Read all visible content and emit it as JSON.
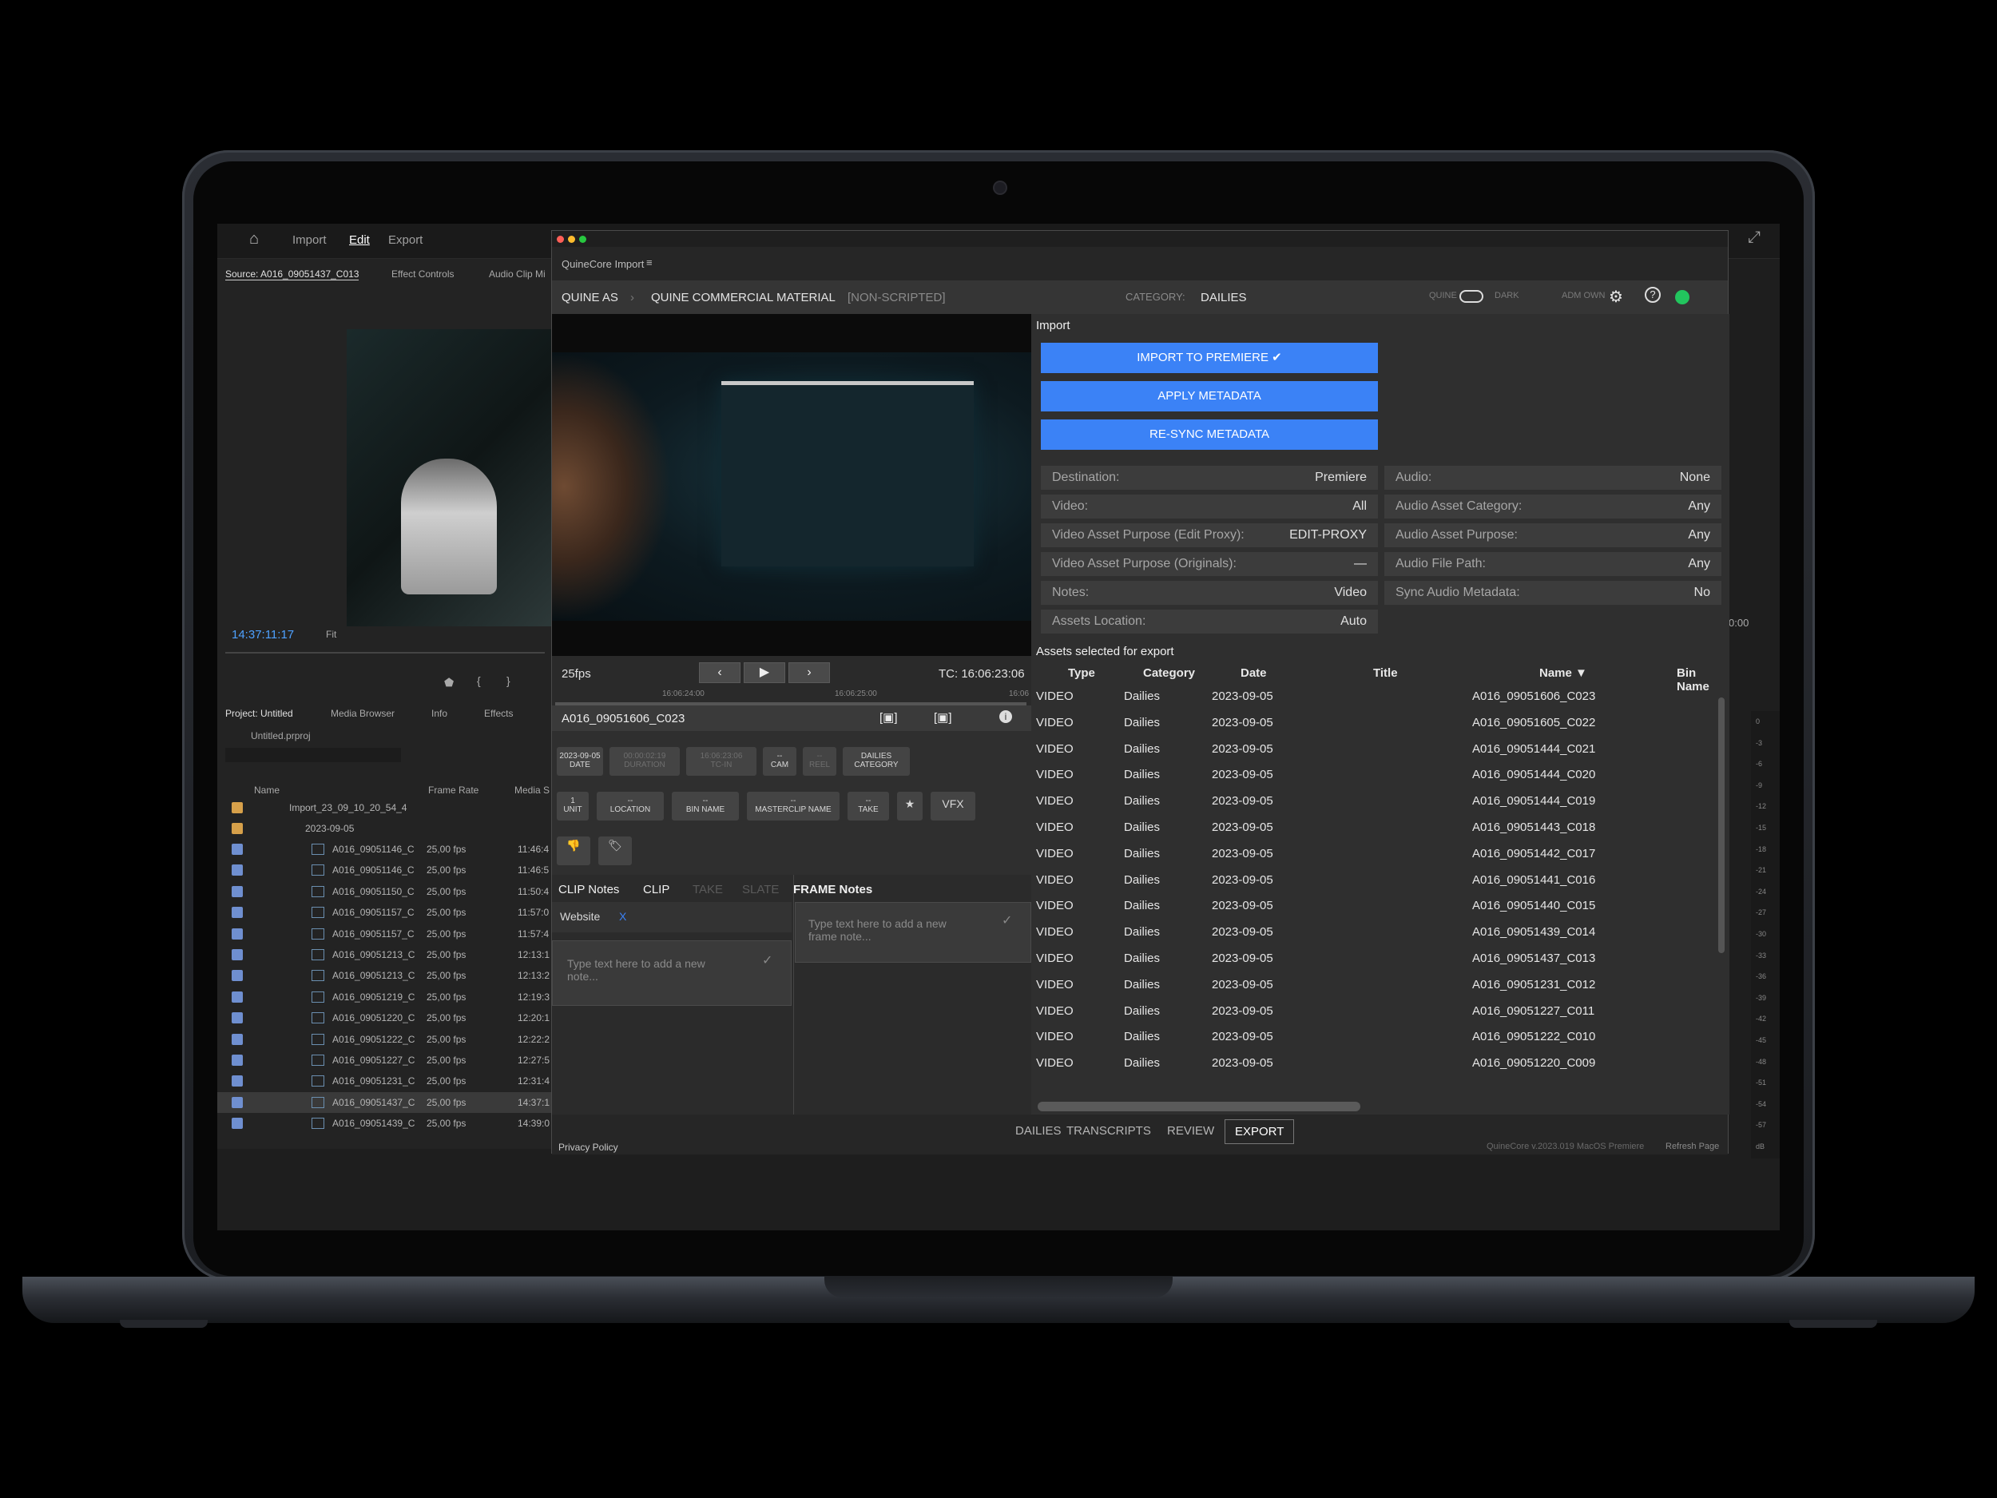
{
  "premiere": {
    "nav": [
      "Import",
      "Edit",
      "Export"
    ],
    "source_tab": "Source: A016_09051437_C013",
    "effect_controls": "Effect Controls",
    "audio_clip_mixer": "Audio Clip Mi",
    "timecode": "14:37:11:17",
    "fit": "Fit",
    "project_tabs": [
      "Project: Untitled",
      "Media Browser",
      "Info",
      "Effects"
    ],
    "project_file": "Untitled.prproj",
    "col_name": "Name",
    "col_frame_rate": "Frame Rate",
    "col_media": "Media S",
    "folder": "Import_23_09_10_20_54_4",
    "subfolder": "2023-09-05",
    "clips": [
      {
        "name": "A016_09051146_C",
        "fps": "25,00 fps",
        "tc": "11:46:4"
      },
      {
        "name": "A016_09051146_C",
        "fps": "25,00 fps",
        "tc": "11:46:5"
      },
      {
        "name": "A016_09051150_C",
        "fps": "25,00 fps",
        "tc": "11:50:4"
      },
      {
        "name": "A016_09051157_C",
        "fps": "25,00 fps",
        "tc": "11:57:0"
      },
      {
        "name": "A016_09051157_C",
        "fps": "25,00 fps",
        "tc": "11:57:4"
      },
      {
        "name": "A016_09051213_C",
        "fps": "25,00 fps",
        "tc": "12:13:1"
      },
      {
        "name": "A016_09051213_C",
        "fps": "25,00 fps",
        "tc": "12:13:2"
      },
      {
        "name": "A016_09051219_C",
        "fps": "25,00 fps",
        "tc": "12:19:3"
      },
      {
        "name": "A016_09051220_C",
        "fps": "25,00 fps",
        "tc": "12:20:1"
      },
      {
        "name": "A016_09051222_C",
        "fps": "25,00 fps",
        "tc": "12:22:2"
      },
      {
        "name": "A016_09051227_C",
        "fps": "25,00 fps",
        "tc": "12:27:5"
      },
      {
        "name": "A016_09051231_C",
        "fps": "25,00 fps",
        "tc": "12:31:4"
      },
      {
        "name": "A016_09051437_C",
        "fps": "25,00 fps",
        "tc": "14:37:1"
      },
      {
        "name": "A016_09051439_C",
        "fps": "25,00 fps",
        "tc": "14:39:0"
      }
    ],
    "right_tc": "0:00"
  },
  "plugin": {
    "window_title": "QuineCore Import",
    "breadcrumb": [
      "QUINE AS",
      "QUINE COMMERCIAL MATERIAL",
      "[NON-SCRIPTED]"
    ],
    "category_label": "CATEGORY:",
    "category_value": "DAILIES",
    "toggle_left": "QUINE",
    "toggle_right": "DARK",
    "user": "ADM  OWN",
    "fps": "25fps",
    "tc": "TC: 16:06:23:06",
    "tick1": "16:06:24:00",
    "tick2": "16:06:25:00",
    "tick3": "16:06",
    "clip_name": "A016_09051606_C023",
    "chips_row1": [
      {
        "top": "2023-09-05",
        "bottom": "DATE",
        "dim": false
      },
      {
        "top": "00:00:02:19",
        "bottom": "DURATION",
        "dim": true
      },
      {
        "top": "16:06:23:06",
        "bottom": "TC-IN",
        "dim": true
      },
      {
        "top": "--",
        "bottom": "CAM",
        "dim": false
      },
      {
        "top": "--",
        "bottom": "REEL",
        "dim": true
      },
      {
        "top": "DAILIES",
        "bottom": "CATEGORY",
        "dim": false
      }
    ],
    "chips_row2": [
      {
        "top": "1",
        "bottom": "UNIT"
      },
      {
        "top": "--",
        "bottom": "LOCATION"
      },
      {
        "top": "--",
        "bottom": "BIN NAME"
      },
      {
        "top": "--",
        "bottom": "MASTERCLIP NAME"
      },
      {
        "top": "--",
        "bottom": "TAKE"
      },
      {
        "top": "★",
        "bottom": ""
      },
      {
        "top": "VFX",
        "bottom": ""
      }
    ],
    "notes_tabs": [
      "CLIP Notes",
      "CLIP",
      "TAKE",
      "SLATE",
      "FRAME Notes"
    ],
    "website_tag": "Website",
    "tag_remove": "X",
    "clip_note_placeholder": "Type text here to add a new note...",
    "frame_note_placeholder": "Type text here to add a new frame note...",
    "import_title": "Import",
    "buttons": [
      "IMPORT TO PREMIERE ✔",
      "APPLY METADATA",
      "RE-SYNC METADATA"
    ],
    "fields_left": [
      {
        "label": "Destination:",
        "value": "Premiere"
      },
      {
        "label": "Video:",
        "value": "All"
      },
      {
        "label": "Video Asset Purpose (Edit Proxy):",
        "value": "EDIT-PROXY"
      },
      {
        "label": "Video Asset Purpose (Originals):",
        "value": "—"
      },
      {
        "label": "Notes:",
        "value": "Video"
      },
      {
        "label": "Assets Location:",
        "value": "Auto"
      }
    ],
    "fields_right": [
      {
        "label": "Audio:",
        "value": "None"
      },
      {
        "label": "Audio Asset Category:",
        "value": "Any"
      },
      {
        "label": "Audio Asset Purpose:",
        "value": "Any"
      },
      {
        "label": "Audio File Path:",
        "value": "Any"
      },
      {
        "label": "Sync Audio Metadata:",
        "value": "No"
      }
    ],
    "assets_title": "Assets selected for export",
    "columns": [
      "Type",
      "Category",
      "Date",
      "Title",
      "Name ▼",
      "Bin Name"
    ],
    "rows": [
      {
        "type": "VIDEO",
        "cat": "Dailies",
        "date": "2023-09-05",
        "title": "",
        "name": "A016_09051606_C023"
      },
      {
        "type": "VIDEO",
        "cat": "Dailies",
        "date": "2023-09-05",
        "title": "",
        "name": "A016_09051605_C022"
      },
      {
        "type": "VIDEO",
        "cat": "Dailies",
        "date": "2023-09-05",
        "title": "",
        "name": "A016_09051444_C021"
      },
      {
        "type": "VIDEO",
        "cat": "Dailies",
        "date": "2023-09-05",
        "title": "",
        "name": "A016_09051444_C020"
      },
      {
        "type": "VIDEO",
        "cat": "Dailies",
        "date": "2023-09-05",
        "title": "",
        "name": "A016_09051444_C019"
      },
      {
        "type": "VIDEO",
        "cat": "Dailies",
        "date": "2023-09-05",
        "title": "",
        "name": "A016_09051443_C018"
      },
      {
        "type": "VIDEO",
        "cat": "Dailies",
        "date": "2023-09-05",
        "title": "",
        "name": "A016_09051442_C017"
      },
      {
        "type": "VIDEO",
        "cat": "Dailies",
        "date": "2023-09-05",
        "title": "",
        "name": "A016_09051441_C016"
      },
      {
        "type": "VIDEO",
        "cat": "Dailies",
        "date": "2023-09-05",
        "title": "",
        "name": "A016_09051440_C015"
      },
      {
        "type": "VIDEO",
        "cat": "Dailies",
        "date": "2023-09-05",
        "title": "",
        "name": "A016_09051439_C014"
      },
      {
        "type": "VIDEO",
        "cat": "Dailies",
        "date": "2023-09-05",
        "title": "",
        "name": "A016_09051437_C013"
      },
      {
        "type": "VIDEO",
        "cat": "Dailies",
        "date": "2023-09-05",
        "title": "",
        "name": "A016_09051231_C012"
      },
      {
        "type": "VIDEO",
        "cat": "Dailies",
        "date": "2023-09-05",
        "title": "",
        "name": "A016_09051227_C011"
      },
      {
        "type": "VIDEO",
        "cat": "Dailies",
        "date": "2023-09-05",
        "title": "",
        "name": "A016_09051222_C010"
      },
      {
        "type": "VIDEO",
        "cat": "Dailies",
        "date": "2023-09-05",
        "title": "",
        "name": "A016_09051220_C009"
      }
    ],
    "bottom_tabs": [
      "DAILIES",
      "TRANSCRIPTS",
      "REVIEW",
      "EXPORT"
    ],
    "privacy": "Privacy Policy",
    "version": "QuineCore v.2023.019 MacOS Premiere",
    "refresh": "Refresh Page",
    "accent": "#3b82f6",
    "status": "#22c55e"
  },
  "meter_ticks": [
    "0",
    "-3",
    "-6",
    "-9",
    "-12",
    "-15",
    "-18",
    "-21",
    "-24",
    "-27",
    "-30",
    "-33",
    "-36",
    "-39",
    "-42",
    "-45",
    "-48",
    "-51",
    "-54",
    "-57",
    "dB"
  ]
}
